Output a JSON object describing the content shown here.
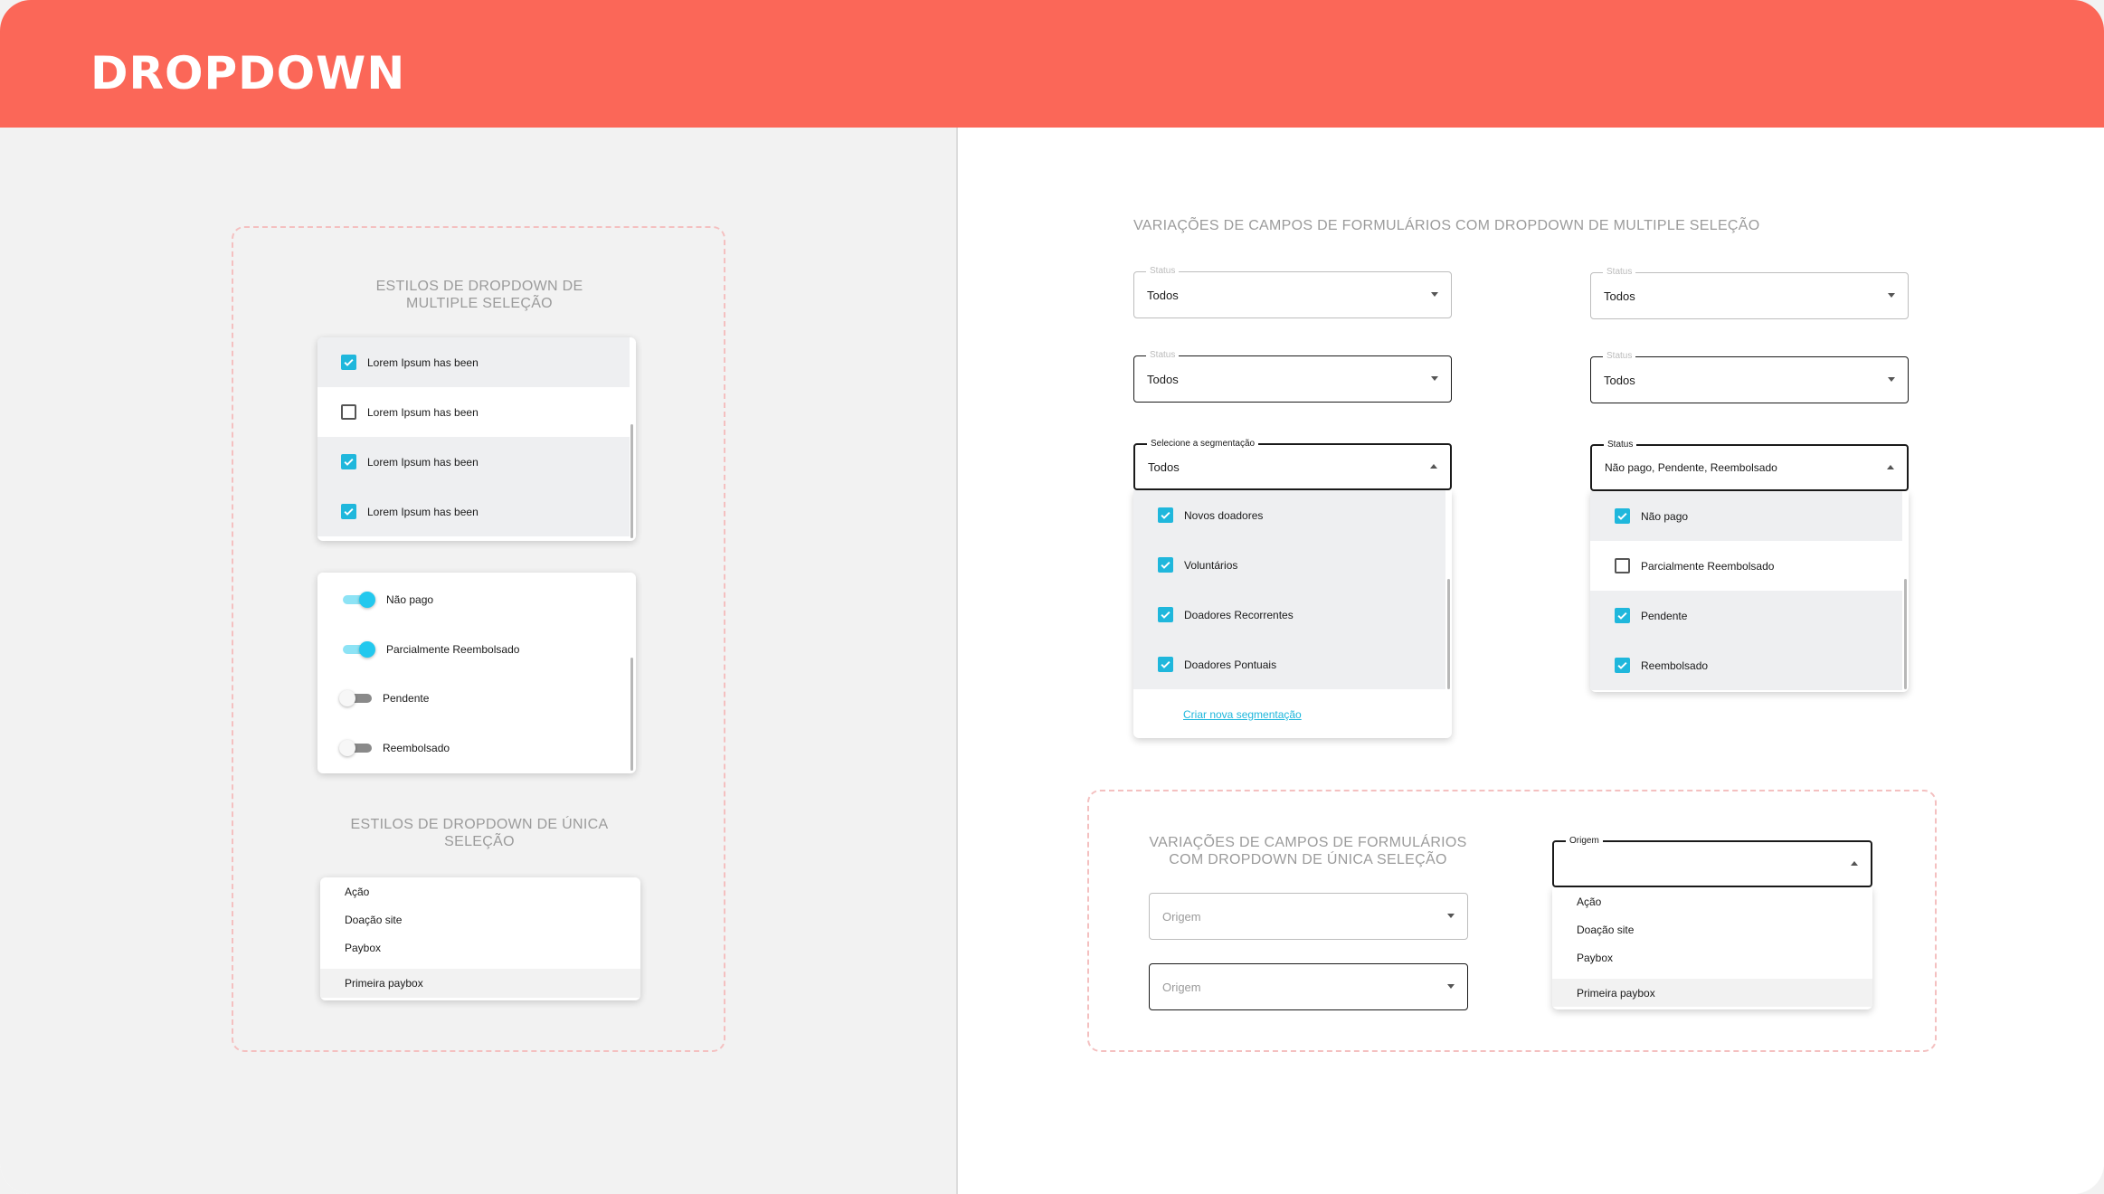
{
  "header": {
    "title": "DROPDOWN"
  },
  "left": {
    "multi_title": "ESTILOS DE DROPDOWN DE MULTIPLE SELEÇÃO",
    "checkbox_list": [
      {
        "label": "Lorem Ipsum has been",
        "checked": true
      },
      {
        "label": "Lorem Ipsum has been",
        "checked": false
      },
      {
        "label": "Lorem Ipsum has been",
        "checked": true
      },
      {
        "label": "Lorem Ipsum has been",
        "checked": true
      }
    ],
    "toggle_list": [
      {
        "label": "Não pago",
        "on": true
      },
      {
        "label": "Parcialmente Reembolsado",
        "on": true
      },
      {
        "label": "Pendente",
        "on": false
      },
      {
        "label": "Reembolsado",
        "on": false
      }
    ],
    "single_title": "ESTILOS DE DROPDOWN DE ÚNICA SELEÇÃO",
    "single_list": [
      "Ação",
      "Doação site",
      "Paybox",
      "Primeira paybox"
    ]
  },
  "right": {
    "multi_title": "VARIAÇÕES DE CAMPOS DE FORMULÁRIOS COM DROPDOWN DE MULTIPLE SELEÇÃO",
    "fields": [
      {
        "label": "Status",
        "value": "Todos"
      },
      {
        "label": "Status",
        "value": "Todos"
      },
      {
        "label": "Status",
        "value": "Todos"
      },
      {
        "label": "Status",
        "value": "Todos"
      }
    ],
    "seg_field": {
      "label": "Selecione a segmentação",
      "value": "Todos"
    },
    "seg_options": [
      {
        "label": "Novos doadores",
        "checked": true
      },
      {
        "label": "Voluntários",
        "checked": true
      },
      {
        "label": "Doadores Recorrentes",
        "checked": true
      },
      {
        "label": "Doadores Pontuais",
        "checked": true
      }
    ],
    "seg_link": "Criar nova segmentação",
    "status_field": {
      "label": "Status",
      "value": "Não pago, Pendente, Reembolsado"
    },
    "status_options": [
      {
        "label": "Não pago",
        "checked": true
      },
      {
        "label": "Parcialmente Reembolsado",
        "checked": false
      },
      {
        "label": "Pendente",
        "checked": true
      },
      {
        "label": "Reembolsado",
        "checked": true
      }
    ],
    "single_title": "VARIAÇÕES DE CAMPOS DE FORMULÁRIOS COM DROPDOWN DE ÚNICA SELEÇÃO",
    "origem_placeholder_1": "Origem",
    "origem_placeholder_2": "Origem",
    "origem_open_label": "Origem",
    "origem_options": [
      "Ação",
      "Doação site",
      "Paybox",
      "Primeira paybox"
    ]
  },
  "colors": {
    "header": "#fb6758",
    "accent": "#1fb7dc"
  }
}
